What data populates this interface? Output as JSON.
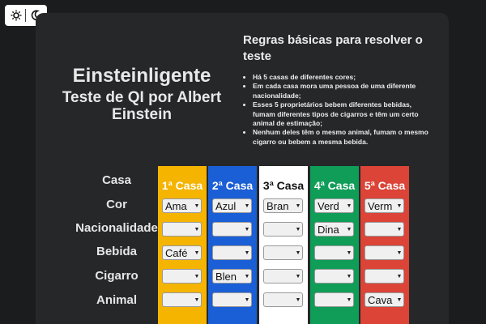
{
  "theme": {
    "light_icon": "sun-icon",
    "dark_icon": "moon-icon"
  },
  "title": {
    "main": "Einsteinligente",
    "sub": "Teste de QI por Albert Einstein"
  },
  "rules": {
    "heading": "Regras básicas para resolver o teste",
    "items": [
      "Há 5 casas de diferentes cores;",
      "Em cada casa mora uma pessoa de uma diferente nacionalidade;",
      "Esses 5 proprietários bebem diferentes bebidas, fumam diferentes tipos de cigarros e têm um certo animal de estimação;",
      "Nenhum deles têm o mesmo animal, fumam o mesmo cigarro ou bebem a mesma bebida."
    ]
  },
  "row_labels": [
    "Casa",
    "Cor",
    "Nacionalidade",
    "Bebida",
    "Cigarro",
    "Animal"
  ],
  "houses": [
    {
      "label": "1ª Casa",
      "color": "#f4b400",
      "text_color": "#ffffff",
      "cor": "Ama",
      "nacionalidade": "",
      "bebida": "Café",
      "cigarro": "",
      "animal": ""
    },
    {
      "label": "2ª Casa",
      "color": "#1b5fd6",
      "text_color": "#ffffff",
      "cor": "Azul",
      "nacionalidade": "",
      "bebida": "",
      "cigarro": "Blen",
      "animal": ""
    },
    {
      "label": "3ª Casa",
      "color": "#ffffff",
      "text_color": "#111111",
      "cor": "Bran",
      "nacionalidade": "",
      "bebida": "",
      "cigarro": "",
      "animal": ""
    },
    {
      "label": "4ª Casa",
      "color": "#0f9d58",
      "text_color": "#ffffff",
      "cor": "Verd",
      "nacionalidade": "Dina",
      "bebida": "",
      "cigarro": "",
      "animal": ""
    },
    {
      "label": "5ª Casa",
      "color": "#db4437",
      "text_color": "#ffffff",
      "cor": "Verm",
      "nacionalidade": "",
      "bebida": "",
      "cigarro": "",
      "animal": "Cava"
    }
  ],
  "select_arrow": "▼"
}
